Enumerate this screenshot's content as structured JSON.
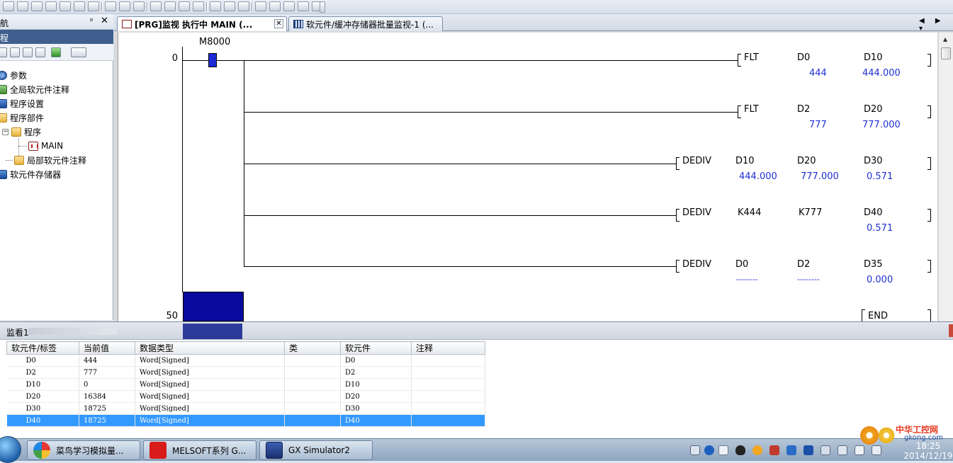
{
  "nav": {
    "title": "导航",
    "title_visible": "航",
    "pin": "ᵖ",
    "close": "✕",
    "section": "工程",
    "section_visible": "程",
    "items": [
      {
        "label": "参数",
        "icon": "parameter-icon"
      },
      {
        "label": "全局软元件注释",
        "icon": "global-comment-icon"
      },
      {
        "label": "程序设置",
        "icon": "program-setting-icon"
      },
      {
        "label": "程序部件",
        "icon": "program-parts-icon"
      },
      {
        "label": "程序",
        "icon": "folder-icon"
      },
      {
        "label": "MAIN",
        "icon": "ladder-program-icon"
      },
      {
        "label": "局部软元件注释",
        "icon": "folder-icon"
      },
      {
        "label": "软元件存储器",
        "icon": "device-memory-icon"
      }
    ]
  },
  "tabs": [
    {
      "label": "[PRG]监视 执行中 MAIN (...",
      "active": true
    },
    {
      "label": "软元件/缓冲存储器批量监视-1 (...",
      "active": false
    }
  ],
  "tab_arrows": "◀ ▶ ▾",
  "ladder": {
    "steps": [
      "0",
      "50"
    ],
    "contact": "M8000",
    "end": "END",
    "rungs": [
      {
        "instr": "FLT",
        "ops": [
          "D0",
          "D10"
        ],
        "vals": [
          "444",
          "444.000"
        ]
      },
      {
        "instr": "FLT",
        "ops": [
          "D2",
          "D20"
        ],
        "vals": [
          "777",
          "777.000"
        ]
      },
      {
        "instr": "DEDIV",
        "ops": [
          "D10",
          "D20",
          "D30"
        ],
        "vals": [
          "444.000",
          "777.000",
          "0.571"
        ]
      },
      {
        "instr": "DEDIV",
        "ops": [
          "K444",
          "K777",
          "D40"
        ],
        "vals": [
          "",
          "",
          "0.571"
        ]
      },
      {
        "instr": "DEDIV",
        "ops": [
          "D0",
          "D2",
          "D35"
        ],
        "vals": [
          "--------",
          "--------",
          "0.000"
        ]
      }
    ]
  },
  "watch": {
    "title": "监看1",
    "columns": [
      "软元件/标签",
      "当前值",
      "数据类型",
      "类",
      "软元件",
      "注释"
    ],
    "rows": [
      [
        "D0",
        "444",
        "Word[Signed]",
        "",
        "D0",
        ""
      ],
      [
        "D2",
        "777",
        "Word[Signed]",
        "",
        "D2",
        ""
      ],
      [
        "D10",
        "0",
        "Word[Signed]",
        "",
        "D10",
        ""
      ],
      [
        "D20",
        "16384",
        "Word[Signed]",
        "",
        "D20",
        ""
      ],
      [
        "D30",
        "18725",
        "Word[Signed]",
        "",
        "D30",
        ""
      ],
      [
        "D40",
        "18725",
        "Word[Signed]",
        "",
        "D40",
        ""
      ]
    ],
    "selected_row": 5
  },
  "taskbar": {
    "tasks": [
      "菜鸟学习模拟量...",
      "MELSOFT系列 G...",
      "GX Simulator2"
    ],
    "clock_time": "18:25",
    "clock_date": "2014/12/19"
  },
  "watermark": {
    "brand": "中华工控网",
    "domain": "gkong.com"
  }
}
